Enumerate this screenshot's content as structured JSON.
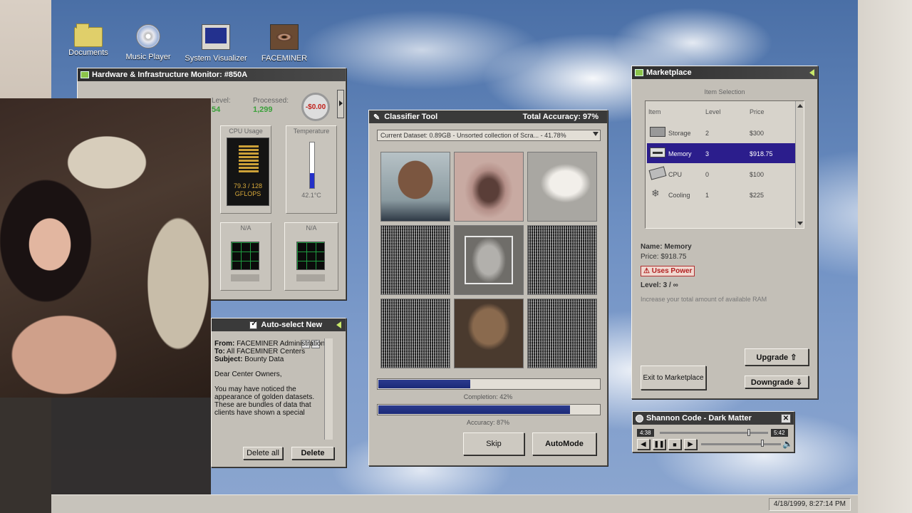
{
  "desktop_icons": [
    {
      "label": "Documents",
      "icon": "folder-icon"
    },
    {
      "label": "Music Player",
      "icon": "cd-icon"
    },
    {
      "label": "System Visualizer",
      "icon": "monitor-icon"
    },
    {
      "label": "FACEMINER",
      "icon": "eye-icon"
    }
  ],
  "hardware_monitor": {
    "title": "Hardware & Infrastructure Monitor: #850A",
    "level_label": "Level:",
    "level_value": "54",
    "processed_label": "Processed:",
    "processed_value": "1,299",
    "balance": "-$0.00",
    "cpu_label": "CPU Usage",
    "cpu_value": "79.3 / 128",
    "cpu_unit": "GFLOPS",
    "temp_label": "Temperature",
    "temp_value": "42.1°C",
    "temp_level": 0.33,
    "slot3_label": "N/A",
    "slot4_label": "N/A"
  },
  "mail": {
    "auto_select_label": "Auto-select New",
    "from_label": "From:",
    "from_value": "FACEMINER Administration",
    "to_label": "To:",
    "to_value": "All FACEMINER Centers",
    "subject_label": "Subject:",
    "subject_value": "Bounty Data",
    "greeting": "Dear Center Owners,",
    "body": "You may have noticed the appearance of golden datasets. These are bundles of data that clients have shown a special",
    "delete_all_label": "Delete all",
    "delete_label": "Delete"
  },
  "classifier": {
    "title": "Classifier Tool",
    "total_accuracy": "Total Accuracy: 97%",
    "dataset": "Current Dataset: 0.89GB - Unsorted collection of Scra... - 41.78%",
    "completion_label": "Completion: 42%",
    "completion_value": 0.42,
    "accuracy_label": "Accuracy: 87%",
    "accuracy_value": 0.87,
    "skip_label": "Skip",
    "automode_label": "AutoMode"
  },
  "marketplace": {
    "title": "Marketplace",
    "group_label": "Item Selection",
    "columns": [
      "Item",
      "Level",
      "Price"
    ],
    "items": [
      {
        "name": "Storage",
        "level": "2",
        "price": "$300",
        "icon": "storage-icon"
      },
      {
        "name": "Memory",
        "level": "3",
        "price": "$918.75",
        "icon": "memory-icon",
        "selected": true
      },
      {
        "name": "CPU",
        "level": "0",
        "price": "$100",
        "icon": "cpu-icon"
      },
      {
        "name": "Cooling",
        "level": "1",
        "price": "$225",
        "icon": "cooling-icon"
      }
    ],
    "detail_name": "Name: Memory",
    "detail_price": "Price: $918.75",
    "uses_power": "⚠ Uses Power",
    "detail_level": "Level: 3 / ∞",
    "description": "Increase your total amount of available RAM",
    "exit_label": "Exit to Marketplace",
    "upgrade_label": "Upgrade ⇧",
    "downgrade_label": "Downgrade ⇩"
  },
  "music_player": {
    "title": "Shannon Code - Dark Matter",
    "elapsed": "4:38",
    "total": "5:42",
    "progress": 0.81,
    "volume": 0.75,
    "close_glyph": "✕",
    "prev_glyph": "◀",
    "pause_glyph": "❚❚",
    "stop_glyph": "■",
    "play_glyph": "▶"
  },
  "taskbar": {
    "clock": "4/18/1999, 8:27:14 PM"
  }
}
